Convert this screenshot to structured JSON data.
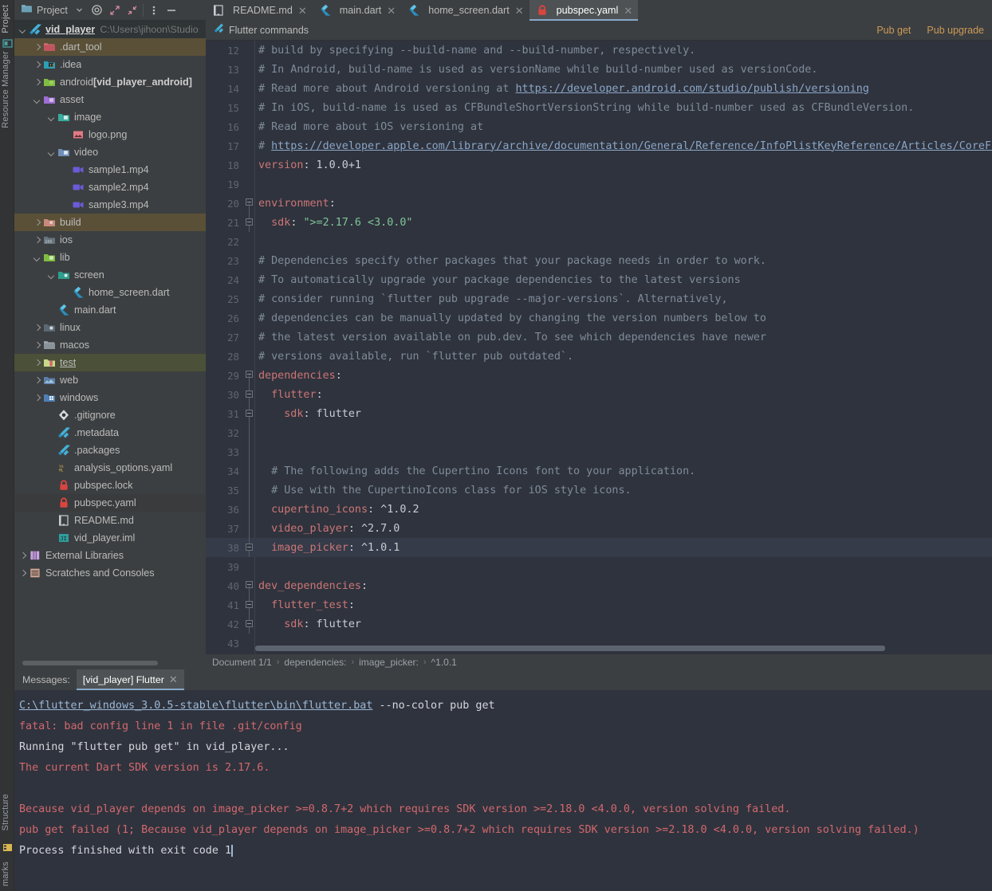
{
  "left_strip": {
    "project_label": "Project",
    "resource_manager_label": "Resource Manager",
    "structure_label": "Structure",
    "bookmarks_label": "marks"
  },
  "project_pane": {
    "title": "Project",
    "icons": [
      "folder-icon",
      "chevron-down-icon",
      "target-icon",
      "expand-icon",
      "collapse-icon",
      "more-vertical-icon",
      "minimize-icon"
    ],
    "tree": [
      {
        "depth": 0,
        "arrow": "down",
        "icon": "flutter-icon",
        "label": "vid_player",
        "path": "C:\\Users\\jihoon\\Studio",
        "style": "root",
        "row": "sel-root"
      },
      {
        "depth": 1,
        "arrow": "right",
        "icon": "folder-red",
        "label": ".dart_tool",
        "row": "hl-darttool"
      },
      {
        "depth": 1,
        "arrow": "right",
        "icon": "folder-idea",
        "label": ".idea"
      },
      {
        "depth": 1,
        "arrow": "right",
        "icon": "folder-android",
        "label": "android ",
        "suffix": "[vid_player_android]"
      },
      {
        "depth": 1,
        "arrow": "down",
        "icon": "folder-asset",
        "label": "asset"
      },
      {
        "depth": 2,
        "arrow": "down",
        "icon": "folder-image",
        "label": "image"
      },
      {
        "depth": 3,
        "arrow": "none",
        "icon": "png-icon",
        "label": "logo.png"
      },
      {
        "depth": 2,
        "arrow": "down",
        "icon": "folder-video",
        "label": "video"
      },
      {
        "depth": 3,
        "arrow": "none",
        "icon": "video-icon",
        "label": "sample1.mp4"
      },
      {
        "depth": 3,
        "arrow": "none",
        "icon": "video-icon",
        "label": "sample2.mp4"
      },
      {
        "depth": 3,
        "arrow": "none",
        "icon": "video-icon",
        "label": "sample3.mp4"
      },
      {
        "depth": 1,
        "arrow": "right",
        "icon": "folder-build",
        "label": "build",
        "row": "hl-build"
      },
      {
        "depth": 1,
        "arrow": "right",
        "icon": "folder-ios",
        "label": "ios"
      },
      {
        "depth": 1,
        "arrow": "down",
        "icon": "folder-lib",
        "label": "lib"
      },
      {
        "depth": 2,
        "arrow": "down",
        "icon": "folder-screen",
        "label": "screen"
      },
      {
        "depth": 3,
        "arrow": "none",
        "icon": "dart-icon",
        "label": "home_screen.dart"
      },
      {
        "depth": 2,
        "arrow": "none",
        "icon": "dart-icon",
        "label": "main.dart"
      },
      {
        "depth": 1,
        "arrow": "right",
        "icon": "folder-linux",
        "label": "linux"
      },
      {
        "depth": 1,
        "arrow": "right",
        "icon": "folder-plain",
        "label": "macos"
      },
      {
        "depth": 1,
        "arrow": "right",
        "icon": "folder-test",
        "label": "test",
        "style": "ul",
        "row": "hl-test"
      },
      {
        "depth": 1,
        "arrow": "right",
        "icon": "folder-web",
        "label": "web"
      },
      {
        "depth": 1,
        "arrow": "right",
        "icon": "folder-windows",
        "label": "windows"
      },
      {
        "depth": 2,
        "arrow": "none",
        "icon": "git-icon",
        "label": ".gitignore"
      },
      {
        "depth": 2,
        "arrow": "none",
        "icon": "flutter-icon",
        "label": ".metadata"
      },
      {
        "depth": 2,
        "arrow": "none",
        "icon": "flutter-icon",
        "label": ".packages"
      },
      {
        "depth": 2,
        "arrow": "none",
        "icon": "yaml-icon",
        "label": "analysis_options.yaml"
      },
      {
        "depth": 2,
        "arrow": "none",
        "icon": "lock-icon",
        "label": "pubspec.lock"
      },
      {
        "depth": 2,
        "arrow": "none",
        "icon": "lock-icon",
        "label": "pubspec.yaml",
        "row": "soft"
      },
      {
        "depth": 2,
        "arrow": "none",
        "icon": "readme-icon",
        "label": "README.md"
      },
      {
        "depth": 2,
        "arrow": "none",
        "icon": "iml-icon",
        "label": "vid_player.iml"
      },
      {
        "depth": 0,
        "arrow": "right",
        "icon": "libraries-icon",
        "label": "External Libraries"
      },
      {
        "depth": 0,
        "arrow": "right",
        "icon": "scratches-icon",
        "label": "Scratches and Consoles"
      }
    ]
  },
  "editor_tabs": [
    {
      "label": "README.md",
      "icon": "readme-icon",
      "active": false
    },
    {
      "label": "main.dart",
      "icon": "dart-icon",
      "active": false
    },
    {
      "label": "home_screen.dart",
      "icon": "dart-icon",
      "active": false
    },
    {
      "label": "pubspec.yaml",
      "icon": "lock-icon",
      "active": true
    }
  ],
  "command_bar": {
    "icon": "flutter-icon",
    "label": "Flutter commands",
    "actions": [
      "Pub get",
      "Pub upgrade"
    ]
  },
  "editor": {
    "lines": [
      {
        "n": 12,
        "fold": "none",
        "tokens": [
          {
            "t": "# build by specifying --build-name and --build-number, respectively.",
            "c": "cm"
          }
        ]
      },
      {
        "n": 13,
        "fold": "none",
        "tokens": [
          {
            "t": "# In Android, build-name is used as versionName while build-number used as versionCode.",
            "c": "cm"
          }
        ]
      },
      {
        "n": 14,
        "fold": "none",
        "tokens": [
          {
            "t": "# Read more about Android versioning at ",
            "c": "cm"
          },
          {
            "t": "https://developer.android.com/studio/publish/versioning",
            "c": "lnk"
          }
        ]
      },
      {
        "n": 15,
        "fold": "none",
        "tokens": [
          {
            "t": "# In iOS, build-name is used as CFBundleShortVersionString while build-number used as CFBundleVersion.",
            "c": "cm"
          }
        ]
      },
      {
        "n": 16,
        "fold": "none",
        "tokens": [
          {
            "t": "# Read more about iOS versioning at",
            "c": "cm"
          }
        ]
      },
      {
        "n": 17,
        "fold": "none",
        "tokens": [
          {
            "t": "# ",
            "c": "cm"
          },
          {
            "t": "https://developer.apple.com/library/archive/documentation/General/Reference/InfoPlistKeyReference/Articles/CoreFou",
            "c": "lnk"
          }
        ]
      },
      {
        "n": 18,
        "fold": "none",
        "tokens": [
          {
            "t": "version",
            "c": "key"
          },
          {
            "t": ": 1.0.0+1",
            "c": "val"
          }
        ]
      },
      {
        "n": 19,
        "fold": "none",
        "tokens": []
      },
      {
        "n": 20,
        "fold": "start",
        "tokens": [
          {
            "t": "environment",
            "c": "key"
          },
          {
            "t": ":",
            "c": "val"
          }
        ]
      },
      {
        "n": 21,
        "fold": "end",
        "tokens": [
          {
            "t": "  sdk",
            "c": "key"
          },
          {
            "t": ": ",
            "c": "val"
          },
          {
            "t": "\">=2.17.6 <3.0.0\"",
            "c": "str"
          }
        ]
      },
      {
        "n": 22,
        "fold": "none",
        "tokens": []
      },
      {
        "n": 23,
        "fold": "none",
        "tokens": [
          {
            "t": "# Dependencies specify other packages that your package needs in order to work.",
            "c": "cm"
          }
        ]
      },
      {
        "n": 24,
        "fold": "none",
        "tokens": [
          {
            "t": "# To automatically upgrade your package dependencies to the latest versions",
            "c": "cm"
          }
        ]
      },
      {
        "n": 25,
        "fold": "none",
        "tokens": [
          {
            "t": "# consider running `flutter pub upgrade --major-versions`. Alternatively,",
            "c": "cm"
          }
        ]
      },
      {
        "n": 26,
        "fold": "none",
        "tokens": [
          {
            "t": "# dependencies can be manually updated by changing the version numbers below to",
            "c": "cm"
          }
        ]
      },
      {
        "n": 27,
        "fold": "none",
        "tokens": [
          {
            "t": "# the latest version available on pub.dev. To see which dependencies have newer",
            "c": "cm"
          }
        ]
      },
      {
        "n": 28,
        "fold": "none",
        "tokens": [
          {
            "t": "# versions available, run `flutter pub outdated`.",
            "c": "cm"
          }
        ]
      },
      {
        "n": 29,
        "fold": "start",
        "tokens": [
          {
            "t": "dependencies",
            "c": "key"
          },
          {
            "t": ":",
            "c": "val"
          }
        ]
      },
      {
        "n": 30,
        "fold": "mid",
        "tokens": [
          {
            "t": "  flutter",
            "c": "key"
          },
          {
            "t": ":",
            "c": "val"
          }
        ]
      },
      {
        "n": 31,
        "fold": "end",
        "tokens": [
          {
            "t": "    sdk",
            "c": "key"
          },
          {
            "t": ": flutter",
            "c": "val"
          }
        ]
      },
      {
        "n": 32,
        "fold": "bar",
        "tokens": []
      },
      {
        "n": 33,
        "fold": "bar",
        "tokens": []
      },
      {
        "n": 34,
        "fold": "bar",
        "tokens": [
          {
            "t": "  # The following adds the Cupertino Icons font to your application.",
            "c": "cm"
          }
        ]
      },
      {
        "n": 35,
        "fold": "bar",
        "tokens": [
          {
            "t": "  # Use with the CupertinoIcons class for iOS style icons.",
            "c": "cm"
          }
        ]
      },
      {
        "n": 36,
        "fold": "bar",
        "tokens": [
          {
            "t": "  cupertino_icons",
            "c": "key"
          },
          {
            "t": ": ^1.0.2",
            "c": "val"
          }
        ]
      },
      {
        "n": 37,
        "fold": "bar",
        "tokens": [
          {
            "t": "  video_player",
            "c": "key"
          },
          {
            "t": ": ^2.7.0",
            "c": "val"
          }
        ]
      },
      {
        "n": 38,
        "fold": "end",
        "cur": true,
        "tokens": [
          {
            "t": "  image_picker",
            "c": "key"
          },
          {
            "t": ": ^1.0.1",
            "c": "val"
          }
        ]
      },
      {
        "n": 39,
        "fold": "none",
        "tokens": []
      },
      {
        "n": 40,
        "fold": "start",
        "tokens": [
          {
            "t": "dev_dependencies",
            "c": "key"
          },
          {
            "t": ":",
            "c": "val"
          }
        ]
      },
      {
        "n": 41,
        "fold": "mid",
        "tokens": [
          {
            "t": "  flutter_test",
            "c": "key"
          },
          {
            "t": ":",
            "c": "val"
          }
        ]
      },
      {
        "n": 42,
        "fold": "end",
        "tokens": [
          {
            "t": "    sdk",
            "c": "key"
          },
          {
            "t": ": flutter",
            "c": "val"
          }
        ]
      },
      {
        "n": 43,
        "fold": "none",
        "tokens": []
      }
    ]
  },
  "breadcrumb": {
    "items": [
      "Document 1/1",
      "dependencies:",
      "image_picker:",
      "^1.0.1"
    ]
  },
  "messages": {
    "title": "Messages:",
    "tab_label": "[vid_player] Flutter",
    "console": [
      {
        "parts": [
          {
            "t": "C:\\flutter_windows_3.0.5-stable\\flutter\\bin\\flutter.bat",
            "c": "c-link"
          },
          {
            "t": " --no-color pub get",
            "c": "c-white"
          }
        ]
      },
      {
        "parts": [
          {
            "t": "fatal: bad config line 1 in file .git/config",
            "c": "c-red"
          }
        ]
      },
      {
        "parts": [
          {
            "t": "Running \"flutter pub get\" in vid_player...",
            "c": "c-white"
          }
        ]
      },
      {
        "parts": [
          {
            "t": "The current Dart SDK version is 2.17.6.",
            "c": "c-red"
          }
        ]
      },
      {
        "parts": []
      },
      {
        "parts": [
          {
            "t": "Because vid_player depends on image_picker >=0.8.7+2 which requires SDK version >=2.18.0 <4.0.0, version solving failed.",
            "c": "c-red"
          }
        ]
      },
      {
        "parts": [
          {
            "t": "pub get failed (1; Because vid_player depends on image_picker >=0.8.7+2 which requires SDK version >=2.18.0 <4.0.0, version solving failed.)",
            "c": "c-red"
          }
        ]
      },
      {
        "parts": [
          {
            "t": "Process finished with exit code 1",
            "c": "c-white"
          }
        ],
        "caret": true
      }
    ]
  },
  "colors": {
    "editor_bg": "#2f333d",
    "panel_bg": "#3c3f41",
    "accent_tab": "#87a9c9",
    "link_action": "#cc9a57",
    "error_red": "#d2686e",
    "yaml_key": "#cb7676",
    "string_green": "#7ec699"
  }
}
